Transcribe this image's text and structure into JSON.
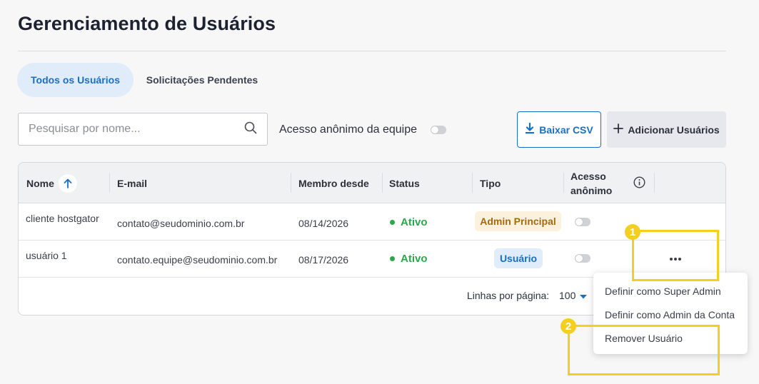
{
  "page": {
    "title": "Gerenciamento de Usuários"
  },
  "tabs": [
    {
      "label": "Todos os Usuários",
      "active": true
    },
    {
      "label": "Solicitações Pendentes",
      "active": false
    }
  ],
  "toolbar": {
    "search_placeholder": "Pesquisar por nome...",
    "search_value": "",
    "anon_team_label": "Acesso anônimo da equipe",
    "csv_label": "Baixar CSV",
    "add_label": "Adicionar Usuários"
  },
  "table": {
    "headers": {
      "name": "Nome",
      "email": "E-mail",
      "member_since": "Membro desde",
      "status": "Status",
      "type": "Tipo",
      "anon_line1": "Acesso",
      "anon_line2": "anônimo"
    },
    "rows": [
      {
        "name": "cliente hostgator",
        "email": "contato@seudominio.com.br",
        "member_since": "08/14/2026",
        "status": "Ativo",
        "type": "Admin Principal"
      },
      {
        "name": "usuário 1",
        "email": "contato.equipe@seudominio.com.br",
        "member_since": "08/17/2026",
        "status": "Ativo",
        "type": "Usuário"
      }
    ],
    "footer": {
      "rows_per_page_label": "Linhas por página:",
      "rows_per_page_value": "100"
    }
  },
  "context_menu": {
    "items": [
      "Definir como Super Admin",
      "Definir como Admin da Conta",
      "Remover Usuário"
    ]
  },
  "annotations": {
    "marker1": "1",
    "marker2": "2"
  },
  "colors": {
    "accent": "#1a6fc4",
    "active_status": "#2ba84a",
    "highlight": "#f4cf1f"
  }
}
